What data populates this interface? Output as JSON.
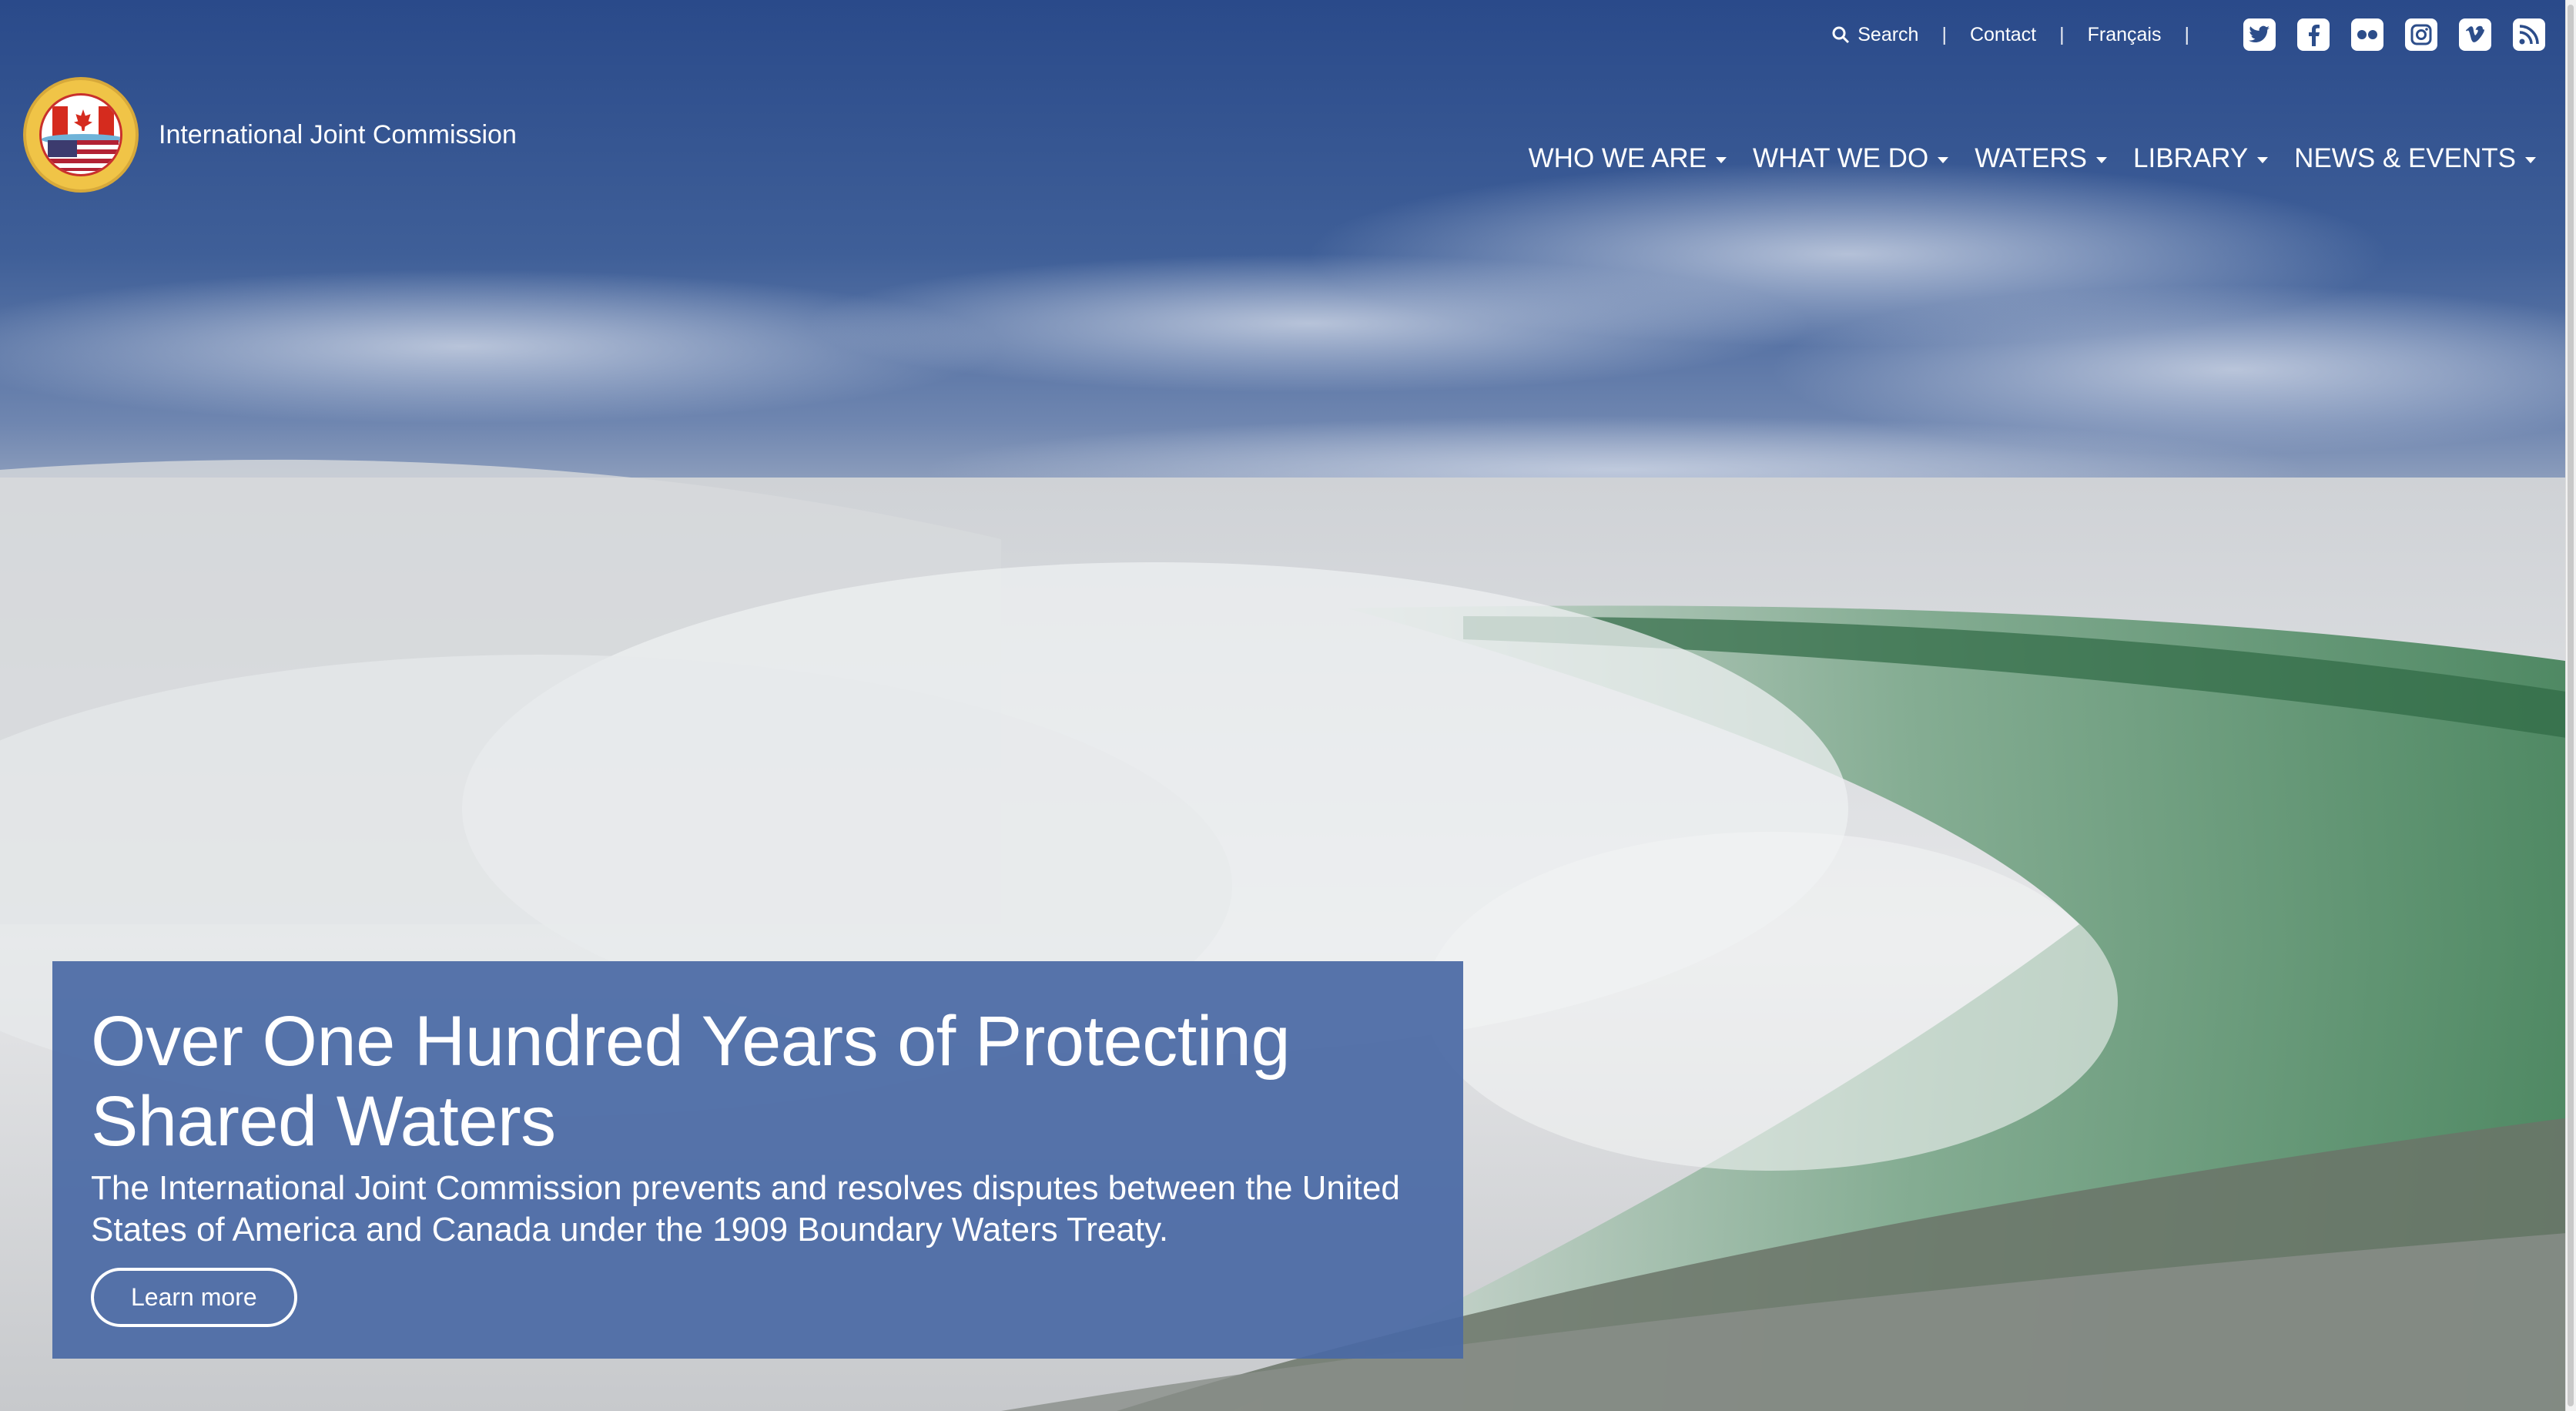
{
  "utility": {
    "search_label": "Search",
    "contact_label": "Contact",
    "language_label": "Français",
    "separator": "|",
    "social": [
      {
        "name": "twitter-icon",
        "glyph": "t"
      },
      {
        "name": "facebook-icon",
        "glyph": "f"
      },
      {
        "name": "flickr-icon",
        "glyph": "••"
      },
      {
        "name": "instagram-icon",
        "glyph": "◎"
      },
      {
        "name": "vimeo-icon",
        "glyph": "v"
      },
      {
        "name": "rss-icon",
        "glyph": "≋"
      }
    ]
  },
  "brand": {
    "org_name": "International Joint Commission"
  },
  "nav": {
    "items": [
      {
        "label": "WHO WE ARE"
      },
      {
        "label": "WHAT WE DO"
      },
      {
        "label": "WATERS"
      },
      {
        "label": "LIBRARY"
      },
      {
        "label": "NEWS & EVENTS"
      }
    ]
  },
  "hero": {
    "title": "Over One Hundred Years of Protecting Shared Waters",
    "description": "The International Joint Commission prevents and resolves disputes between the United States of America and Canada under the 1909 Boundary Waters Treaty.",
    "cta_label": "Learn more"
  },
  "colors": {
    "sky_top": "#2a4a8a",
    "callout_bg": "#4a69a5",
    "falls_green": "#4d8a5e"
  }
}
